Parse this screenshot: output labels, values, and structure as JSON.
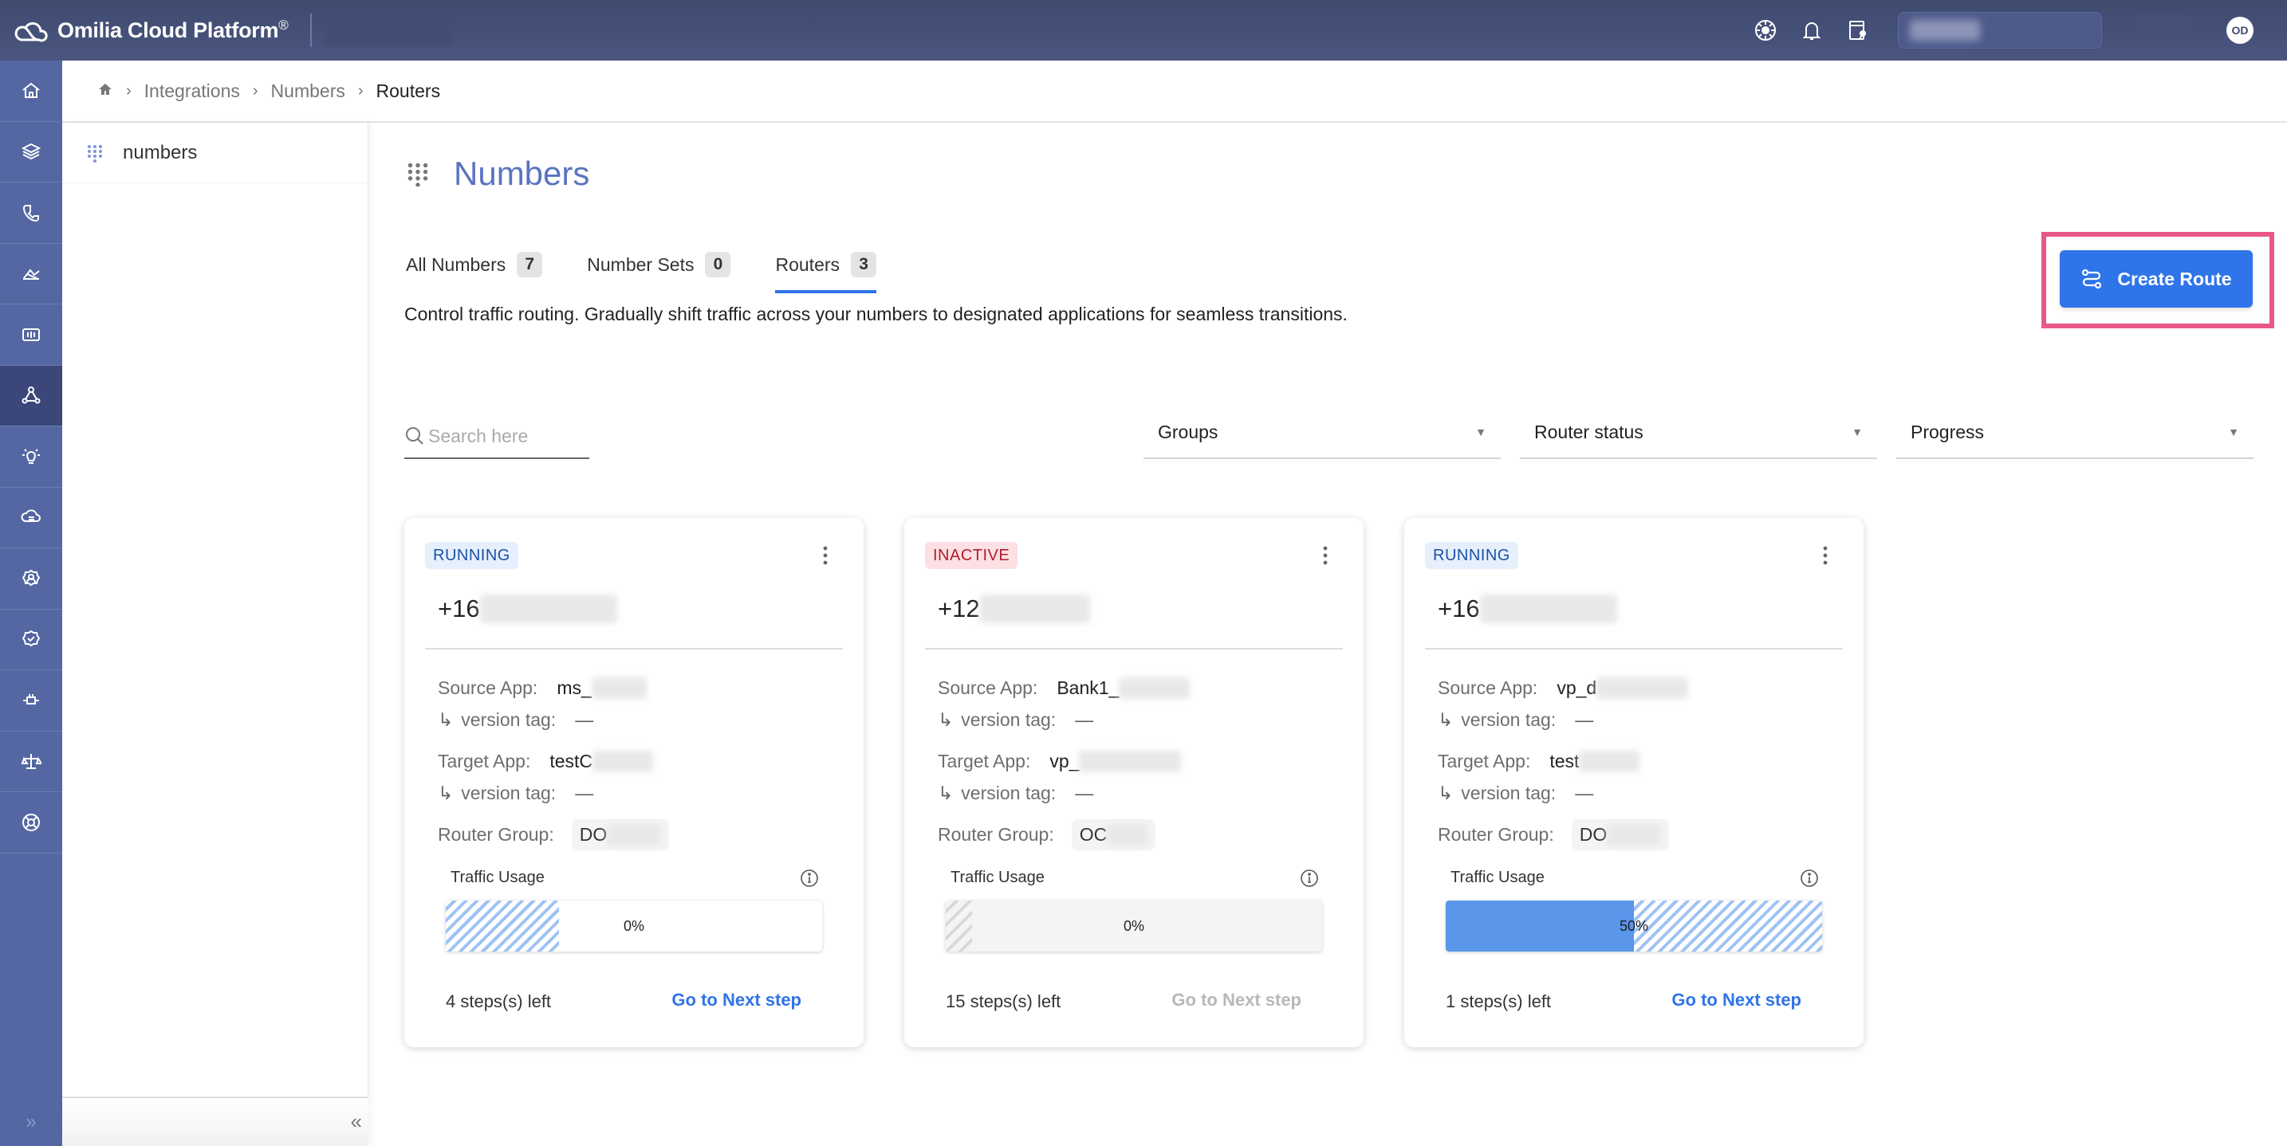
{
  "app": {
    "title": "Omilia Cloud Platform",
    "trademark": "®",
    "user_initials": "OD"
  },
  "topbar": {
    "icons": [
      "help-wheel-icon",
      "bell-icon",
      "license-key-icon"
    ]
  },
  "leftnav": {
    "items": [
      {
        "name": "home",
        "icon": "home-icon",
        "active": false
      },
      {
        "name": "layers",
        "icon": "layers-icon",
        "active": false
      },
      {
        "name": "phone",
        "icon": "phone-icon",
        "active": false
      },
      {
        "name": "analytics",
        "icon": "analytics-icon",
        "active": false
      },
      {
        "name": "monitor",
        "icon": "monitor-icon",
        "active": false
      },
      {
        "name": "integrations",
        "icon": "integrations-icon",
        "active": true
      },
      {
        "name": "insights",
        "icon": "lightbulb-icon",
        "active": false
      },
      {
        "name": "cloud",
        "icon": "cloud-icon",
        "active": false
      },
      {
        "name": "user-settings",
        "icon": "user-gear-icon",
        "active": false
      },
      {
        "name": "verified",
        "icon": "verified-gear-icon",
        "active": false
      },
      {
        "name": "plug",
        "icon": "plug-icon",
        "active": false
      },
      {
        "name": "legal",
        "icon": "scale-icon",
        "active": false
      },
      {
        "name": "support",
        "icon": "lifebuoy-icon",
        "active": false
      }
    ]
  },
  "breadcrumb": {
    "items": [
      "Integrations",
      "Numbers"
    ],
    "current": "Routers"
  },
  "sidepanel": {
    "item": "numbers"
  },
  "page": {
    "title": "Numbers",
    "description": "Control traffic routing. Gradually shift traffic across your numbers to designated applications for seamless transitions.",
    "create_button": "Create Route"
  },
  "tabs": [
    {
      "label": "All Numbers",
      "count": "7",
      "active": false
    },
    {
      "label": "Number Sets",
      "count": "0",
      "active": false
    },
    {
      "label": "Routers",
      "count": "3",
      "active": true
    }
  ],
  "filters": {
    "search_placeholder": "Search here",
    "groups": "Groups",
    "router_status": "Router status",
    "progress": "Progress"
  },
  "labels": {
    "source_app": "Source App:",
    "target_app": "Target App:",
    "version_tag": "version tag:",
    "router_group": "Router Group:",
    "traffic_usage": "Traffic Usage",
    "next_step": "Go to Next step"
  },
  "cards": [
    {
      "status": "RUNNING",
      "phone_prefix": "+16",
      "phone_hidden": "8543854479",
      "source_app_prefix": "ms_",
      "source_app_hidden": "abcd_t",
      "source_version": "—",
      "target_app_prefix": "testC",
      "target_app_hidden": "anthing",
      "target_version": "—",
      "router_group_prefix": "DO",
      "router_group_hidden": "C7647",
      "traffic_pct": 0,
      "traffic_label": "0%",
      "stripe_pct": 30,
      "steps_left": "4 steps(s) left",
      "next_enabled": true
    },
    {
      "status": "INACTIVE",
      "phone_prefix": "+12",
      "phone_hidden": "67388532",
      "source_app_prefix": "Bank1_",
      "source_app_hidden": "1001test",
      "source_version": "—",
      "target_app_prefix": "vp_",
      "target_app_hidden": "data_ranges",
      "target_version": "—",
      "router_group_prefix": "OC",
      "router_group_hidden": "h1gd",
      "traffic_pct": 0,
      "traffic_label": "0%",
      "stripe_pct": 7,
      "steps_left": "15 steps(s) left",
      "next_enabled": false
    },
    {
      "status": "RUNNING",
      "phone_prefix": "+16",
      "phone_hidden": "8123535385",
      "source_app_prefix": "vp_d",
      "source_app_hidden": "ata_ranges",
      "source_version": "—",
      "target_app_prefix": "test",
      "target_app_hidden": "anthing",
      "target_version": "—",
      "router_group_prefix": "DO",
      "router_group_hidden": "C7647",
      "traffic_pct": 50,
      "traffic_label": "50%",
      "stripe_pct": 50,
      "steps_left": "1 steps(s) left",
      "next_enabled": true
    }
  ],
  "colors": {
    "accent": "#2f74e8",
    "nav_bg": "#5467a3",
    "topbar_bg": "#3f4a6e",
    "running_text": "#1d4fa8",
    "inactive_text": "#b01e2a",
    "highlight": "#e9578a"
  }
}
